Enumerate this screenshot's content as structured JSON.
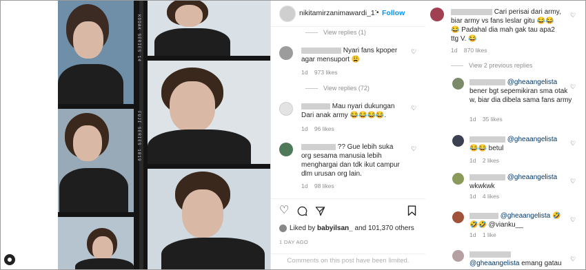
{
  "post": {
    "username": "nikitamirzanimawardi_172",
    "follow_label": "Follow",
    "separator": "•",
    "likes_prefix": "Liked by",
    "likes_user": "babyilsan_",
    "likes_suffix": "and 101,370 others",
    "time_ago": "1 DAY AGO",
    "comments_limited": "Comments on this post have been limited."
  },
  "photo": {
    "film_text_1": "FUJI SERIES 1819",
    "film_text_2": "KODAK SERIES 14"
  },
  "comments": [
    {
      "view_replies": "View replies (1)"
    },
    {
      "text": "Nyari fans kpoper agar mensuport 😩",
      "age": "1d",
      "likes": "973 likes",
      "view_replies": "View replies (72)"
    },
    {
      "text": "Mau nyari dukungan Dari anak army 😂😂😂😂.",
      "age": "1d",
      "likes": "96 likes"
    },
    {
      "text": "?? Gue lebih suka org sesama manusia lebih menghargai dan tdk ikut campur dlm urusan org lain.",
      "age": "1d",
      "likes": "98 likes"
    }
  ],
  "side_comments": {
    "main": {
      "text": "Cari perisai dari army, biar army vs fans leslar gitu 😂😂😂 Padahal dia mah gak tau apa2 ttg V. 😂",
      "age": "1d",
      "likes": "870 likes"
    },
    "view_previous": "View 2 previous replies",
    "replies": [
      {
        "mention": "@gheaangelista",
        "text": "bener bgt sepemikiran sma otak w, biar dia dibela sama fans army",
        "age": "1d",
        "likes": "35 likes"
      },
      {
        "mention": "@gheaangelista",
        "text": "😂😂 betul",
        "age": "1d",
        "likes": "2 likes"
      },
      {
        "mention": "@gheaangelista",
        "text": "wkwkwk",
        "age": "1d",
        "likes": "4 likes"
      },
      {
        "mention": "@gheaangelista",
        "emoji": "🤣",
        "text": "🤣🤣 @vianku__",
        "age": "1d",
        "likes": "1 like"
      },
      {
        "mention": "@gheaangelista",
        "text": "emang gatau"
      }
    ]
  },
  "colors": {
    "link": "#0095f6",
    "mention": "#00376b",
    "muted": "#8e8e8e",
    "text": "#262626"
  },
  "icons": {
    "like": "heart-icon",
    "comment": "comment-icon",
    "share": "share-icon",
    "save": "bookmark-icon"
  }
}
